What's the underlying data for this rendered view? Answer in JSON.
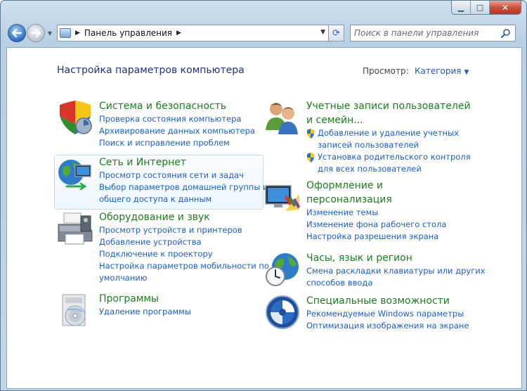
{
  "window": {
    "caption": {
      "minimize": "▁",
      "maximize": "□",
      "close": "✕"
    }
  },
  "navbar": {
    "address_text": "Панель управления",
    "search_placeholder": "Поиск в панели управления"
  },
  "header": {
    "title": "Настройка параметров компьютера",
    "view_label": "Просмотр:",
    "view_value": "Категория"
  },
  "categories": {
    "system": {
      "title": "Система и безопасность",
      "links": [
        "Проверка состояния компьютера",
        "Архивирование данных компьютера",
        "Поиск и исправление проблем"
      ]
    },
    "network": {
      "title": "Сеть и Интернет",
      "links": [
        "Просмотр состояния сети и задач",
        "Выбор параметров домашней группы и",
        "общего доступа к данным"
      ]
    },
    "hardware": {
      "title": "Оборудование и звук",
      "links": [
        "Просмотр устройств и принтеров",
        "Добавление устройства",
        "Подключение к проектору",
        "Настройка параметров мобильности по",
        "умолчанию"
      ]
    },
    "programs": {
      "title": "Программы",
      "links": [
        "Удаление программы"
      ]
    },
    "accounts": {
      "title_line1": "Учетные записи пользователей",
      "title_line2": "и семейн...",
      "links": [
        "Добавление и удаление учетных",
        "записей пользователей",
        "Установка родительского контроля",
        "для всех пользователей"
      ]
    },
    "appearance": {
      "title_line1": "Оформление и",
      "title_line2": "персонализация",
      "links": [
        "Изменение темы",
        "Изменение фона рабочего стола",
        "Настройка разрешения экрана"
      ]
    },
    "clock": {
      "title": "Часы, язык и регион",
      "links": [
        "Смена раскладки клавиатуры или других",
        "способов ввода"
      ]
    },
    "access": {
      "title": "Специальные возможности",
      "links": [
        "Рекомендуемые Windows параметры",
        "Оптимизация изображения на экране"
      ]
    }
  },
  "icons": {
    "system": "security-shield-icon",
    "network": "globe-network-icon",
    "hardware": "printer-icon",
    "programs": "programs-disc-icon",
    "accounts": "users-icon",
    "appearance": "monitor-paint-icon",
    "clock": "clock-globe-icon",
    "access": "accessibility-icon",
    "uac": "uac-shield-icon"
  }
}
